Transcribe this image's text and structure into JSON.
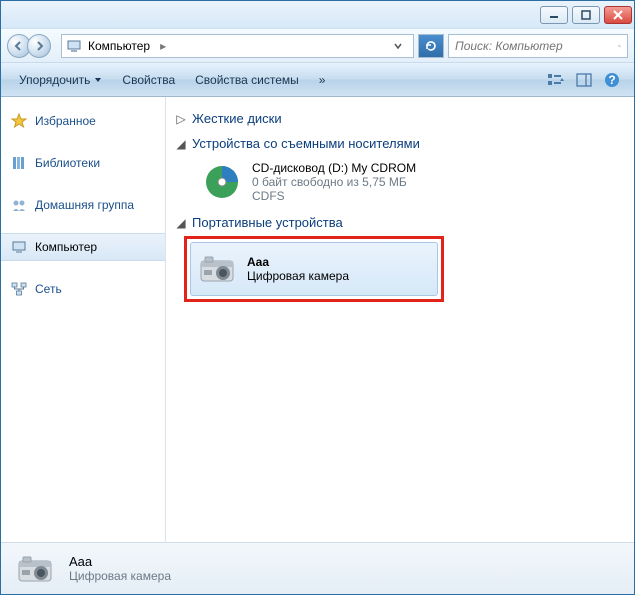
{
  "titlebar": {
    "min": "—",
    "max": "☐",
    "close": "×"
  },
  "breadcrumb": {
    "root_label": "Компьютер"
  },
  "search": {
    "placeholder": "Поиск: Компьютер"
  },
  "toolbar": {
    "organize": "Упорядочить",
    "properties": "Свойства",
    "system_properties": "Свойства системы",
    "chevron": "»"
  },
  "sidebar": {
    "favorites": "Избранное",
    "libraries": "Библиотеки",
    "homegroup": "Домашняя группа",
    "computer": "Компьютер",
    "network": "Сеть"
  },
  "groups": {
    "hdd": "Жесткие диски",
    "removable": "Устройства со съемными носителями",
    "portable": "Портативные устройства"
  },
  "cd": {
    "name": "CD-дисковод (D:) My CDROM",
    "free": "0 байт свободно из 5,75 МБ",
    "fs": "CDFS"
  },
  "camera": {
    "name": "Aaa",
    "type": "Цифровая камера"
  },
  "status": {
    "name": "Aaa",
    "type": "Цифровая камера"
  }
}
